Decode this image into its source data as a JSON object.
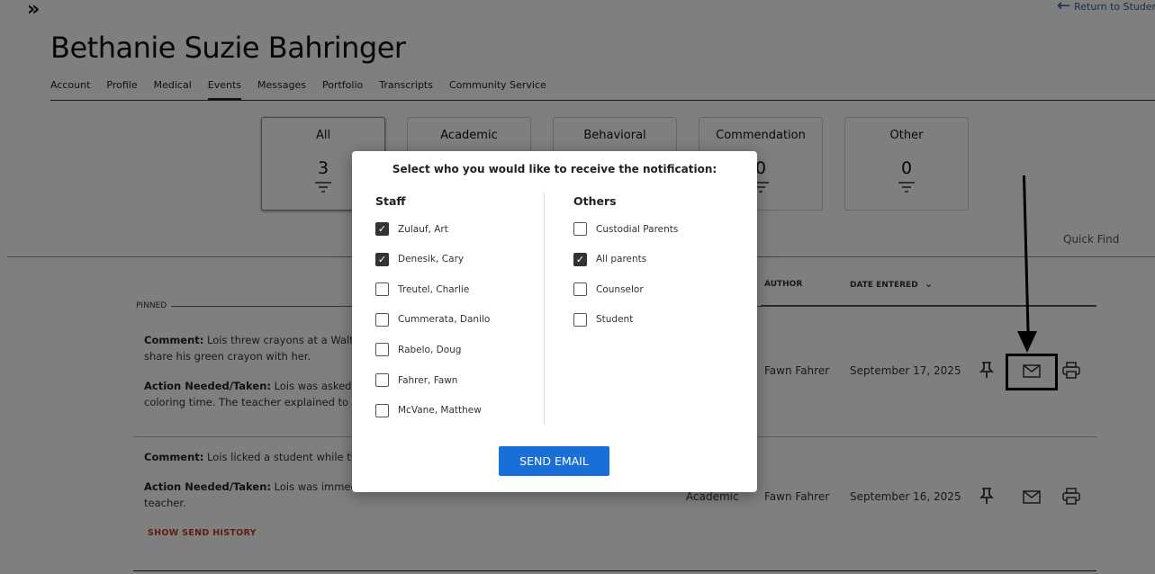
{
  "header": {
    "expand_glyph": "»",
    "return_label": "Return to Studen",
    "student_name": "Bethanie Suzie Bahringer"
  },
  "tabs": [
    {
      "label": "Account"
    },
    {
      "label": "Profile"
    },
    {
      "label": "Medical"
    },
    {
      "label": "Events"
    },
    {
      "label": "Messages"
    },
    {
      "label": "Portfolio"
    },
    {
      "label": "Transcripts"
    },
    {
      "label": "Community Service"
    }
  ],
  "active_tab": "Events",
  "filter_cards": [
    {
      "label": "All",
      "count": "3"
    },
    {
      "label": "Academic",
      "count": ""
    },
    {
      "label": "Behavioral",
      "count": ""
    },
    {
      "label": "Commendation",
      "count": "0"
    },
    {
      "label": "Other",
      "count": "0"
    }
  ],
  "quick_find_label": "Quick Find",
  "table": {
    "col_author": "AUTHOR",
    "col_date": "DATE ENTERED",
    "pinned_label": "PINNED"
  },
  "events": [
    {
      "comment_label": "Comment:",
      "comment": "Lois threw crayons at a Walte",
      "comment_line2": "share his green crayon with her.",
      "action_label": "Action Needed/Taken:",
      "action": "Lois was asked to",
      "action_line2": "coloring time. The teacher explained to h",
      "type": "",
      "author": "Fawn Fahrer",
      "date": "September 17, 2025"
    },
    {
      "comment_label": "Comment:",
      "comment": "Lois licked a student while th",
      "action_label": "Action Needed/Taken:",
      "action": "Lois was immedi",
      "action_line2": "teacher.",
      "type": "Academic",
      "author": "Fawn Fahrer",
      "date": "September 16, 2025",
      "show_history": "SHOW SEND HISTORY"
    }
  ],
  "modal": {
    "title": "Select who you would like to receive the notification:",
    "staff_heading": "Staff",
    "others_heading": "Others",
    "staff": [
      {
        "name": "Zulauf, Art",
        "checked": true
      },
      {
        "name": "Denesik, Cary",
        "checked": true
      },
      {
        "name": "Treutel, Charlie",
        "checked": false
      },
      {
        "name": "Cummerata, Danilo",
        "checked": false
      },
      {
        "name": "Rabelo, Doug",
        "checked": false
      },
      {
        "name": "Fahrer, Fawn",
        "checked": false
      },
      {
        "name": "McVane, Matthew",
        "checked": false
      }
    ],
    "others": [
      {
        "name": "Custodial Parents",
        "checked": false
      },
      {
        "name": "All parents",
        "checked": true
      },
      {
        "name": "Counselor",
        "checked": false
      },
      {
        "name": "Student",
        "checked": false
      }
    ],
    "send_label": "SEND EMAIL"
  }
}
